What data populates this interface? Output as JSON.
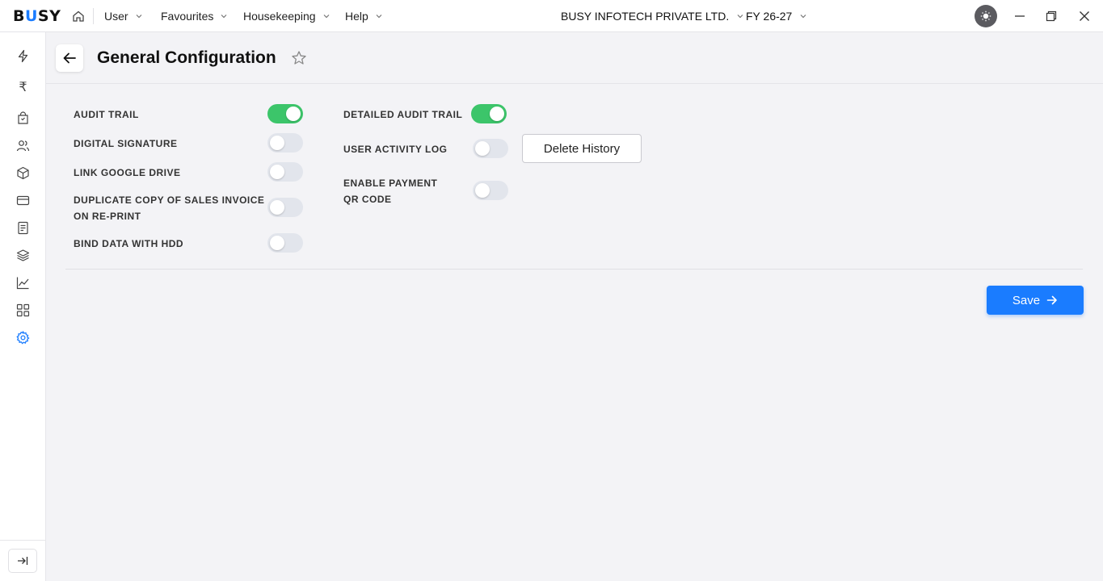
{
  "brand": {
    "logo_text_b": "B",
    "logo_text_u": "U",
    "logo_text_sy": "SY",
    "accent": "#1a7cff"
  },
  "topbar": {
    "menus": [
      {
        "label": "User"
      },
      {
        "label": "Favourites"
      },
      {
        "label": "Housekeeping"
      },
      {
        "label": "Help"
      }
    ],
    "company": "BUSY INFOTECH PRIVATE LTD.",
    "fy": "FY 26-27",
    "icons": [
      "home-icon",
      "chevron-down-icon",
      "sun-icon",
      "minimize-icon",
      "restore-icon",
      "close-icon"
    ]
  },
  "sidebar": {
    "icons": [
      "lightning-icon",
      "rupee-icon",
      "shopping-bag-icon",
      "users-icon",
      "box-icon",
      "card-icon",
      "document-icon",
      "layers-icon",
      "line-chart-icon",
      "grid-icon",
      "settings-icon",
      "collapse-icon"
    ],
    "rupee_glyph": "₹",
    "active_color": "#1a7cff"
  },
  "page": {
    "title": "General Configuration"
  },
  "settings": {
    "left": [
      {
        "label": "AUDIT TRAIL",
        "on": true
      },
      {
        "label": "DIGITAL SIGNATURE",
        "on": false
      },
      {
        "label": "LINK GOOGLE DRIVE",
        "on": false
      },
      {
        "label_line1": "DUPLICATE COPY OF SALES INVOICE",
        "label_line2": "ON RE-PRINT",
        "on": false
      },
      {
        "label": "BIND DATA WITH HDD",
        "on": false
      }
    ],
    "right": [
      {
        "label": "DETAILED AUDIT TRAIL",
        "on": true
      },
      {
        "label": "USER ACTIVITY LOG",
        "on": false
      },
      {
        "label_line1": "ENABLE PAYMENT",
        "label_line2": "QR CODE",
        "on": false
      }
    ],
    "delete_history_label": "Delete History",
    "toggle_on_color": "#3cc56a",
    "toggle_off_color": "#e2e5ec"
  },
  "footer": {
    "save_label": "Save"
  }
}
